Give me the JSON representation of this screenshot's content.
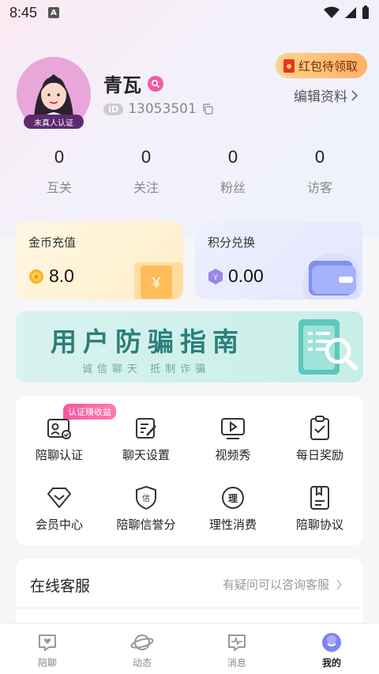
{
  "status": {
    "time": "8:45"
  },
  "profile": {
    "nickname": "青瓦",
    "id_tag": "ID",
    "id": "13053501",
    "avatar_badge": "未真人认证",
    "redpack": "红包待领取",
    "edit": "编辑资料"
  },
  "stats": [
    {
      "num": "0",
      "label": "互关"
    },
    {
      "num": "0",
      "label": "关注"
    },
    {
      "num": "0",
      "label": "粉丝"
    },
    {
      "num": "0",
      "label": "访客"
    }
  ],
  "wallet": {
    "coin_title": "金币充值",
    "coin_value": "8.0",
    "point_title": "积分兑换",
    "point_value": "0.00",
    "coin_symbol": "¥",
    "point_symbol": "Y"
  },
  "banner": {
    "title": "用户防骗指南",
    "subtitle": "诚信聊天  抵制诈骗"
  },
  "grid": {
    "tag": "认证赚收益",
    "items": [
      {
        "label": "陪聊认证",
        "icon": "id-card-icon"
      },
      {
        "label": "聊天设置",
        "icon": "edit-icon"
      },
      {
        "label": "视频秀",
        "icon": "video-icon"
      },
      {
        "label": "每日奖励",
        "icon": "clipboard-icon"
      },
      {
        "label": "会员中心",
        "icon": "diamond-icon"
      },
      {
        "label": "陪聊信誉分",
        "icon": "shield-icon",
        "glyph": "信"
      },
      {
        "label": "理性消费",
        "icon": "circle-icon",
        "glyph": "理"
      },
      {
        "label": "陪聊协议",
        "icon": "document-icon"
      }
    ]
  },
  "service": {
    "title": "在线客服",
    "hint": "有疑问可以咨询客服"
  },
  "tabs": [
    {
      "label": "陪聊",
      "icon": "heart-chat-icon"
    },
    {
      "label": "动态",
      "icon": "planet-icon"
    },
    {
      "label": "消息",
      "icon": "message-icon"
    },
    {
      "label": "我的",
      "icon": "me-icon"
    }
  ],
  "colors": {
    "accent": "#2c7f7a",
    "pink": "#f25aa5",
    "gold": "#ffb067"
  }
}
